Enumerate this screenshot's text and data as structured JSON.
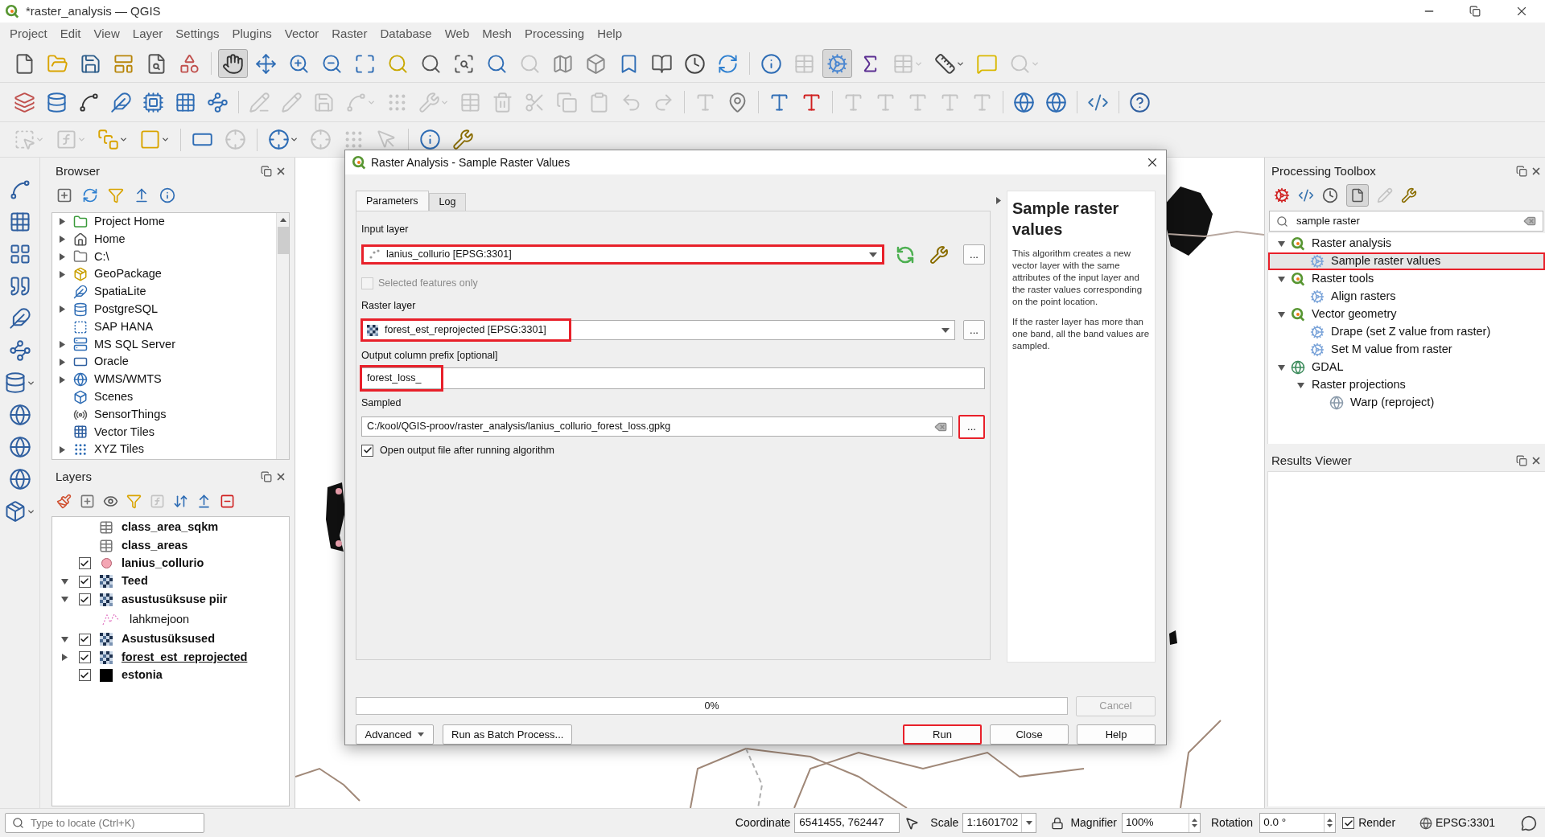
{
  "window": {
    "title": "*raster_analysis — QGIS"
  },
  "menu": [
    "Project",
    "Edit",
    "View",
    "Layer",
    "Settings",
    "Plugins",
    "Vector",
    "Raster",
    "Database",
    "Web",
    "Mesh",
    "Processing",
    "Help"
  ],
  "toolbars": [
    {
      "buttons": [
        {
          "disabled": false,
          "pressed": false
        },
        {
          "disabled": false,
          "pressed": false
        },
        {
          "disabled": false,
          "pressed": false
        },
        {
          "disabled": false,
          "pressed": false
        },
        {
          "disabled": false,
          "pressed": false
        },
        {
          "disabled": false,
          "pressed": false
        },
        {
          "disabled": false,
          "pressed": true
        },
        {
          "disabled": false,
          "pressed": false
        },
        {
          "disabled": false,
          "pressed": false
        },
        {
          "disabled": false,
          "pressed": false
        },
        {
          "disabled": false,
          "pressed": false
        },
        {
          "disabled": false,
          "pressed": false
        },
        {
          "disabled": false,
          "pressed": false
        },
        {
          "disabled": false,
          "pressed": false
        },
        {
          "disabled": false,
          "pressed": false
        },
        {
          "disabled": true,
          "pressed": false
        },
        {
          "disabled": false,
          "pressed": false
        },
        {
          "disabled": false,
          "pressed": false
        },
        {
          "disabled": false,
          "pressed": false
        },
        {
          "disabled": false,
          "pressed": false
        },
        {
          "disabled": false,
          "pressed": false
        },
        {
          "disabled": false,
          "pressed": false
        },
        {
          "disabled": false,
          "pressed": false
        },
        {
          "disabled": true,
          "pressed": false
        },
        {
          "disabled": false,
          "pressed": true
        },
        {
          "disabled": false,
          "pressed": false
        },
        {
          "disabled": true,
          "pressed": false
        },
        {
          "disabled": false,
          "pressed": false
        },
        {
          "disabled": false,
          "pressed": false
        },
        {
          "disabled": true,
          "pressed": false
        }
      ]
    },
    {
      "buttons": [
        {
          "disabled": false
        },
        {
          "disabled": false
        },
        {
          "disabled": false
        },
        {
          "disabled": false
        },
        {
          "disabled": false
        },
        {
          "disabled": false
        },
        {
          "disabled": false
        },
        {
          "disabled": true
        },
        {
          "disabled": true
        },
        {
          "disabled": true
        },
        {
          "disabled": true
        },
        {
          "disabled": true
        },
        {
          "disabled": true
        },
        {
          "disabled": true
        },
        {
          "disabled": true
        },
        {
          "disabled": true
        },
        {
          "disabled": true
        },
        {
          "disabled": true
        },
        {
          "disabled": true
        },
        {
          "disabled": true
        },
        {
          "disabled": true
        },
        {
          "disabled": false
        },
        {
          "disabled": false
        },
        {
          "disabled": false
        },
        {
          "disabled": true
        },
        {
          "disabled": true
        },
        {
          "disabled": true
        },
        {
          "disabled": true
        },
        {
          "disabled": true
        },
        {
          "disabled": false
        },
        {
          "disabled": false
        },
        {
          "disabled": false
        },
        {
          "disabled": false
        }
      ]
    },
    {
      "buttons": [
        {
          "disabled": true
        },
        {
          "disabled": true
        },
        {
          "disabled": false
        },
        {
          "disabled": false
        },
        {
          "disabled": false
        },
        {
          "disabled": true
        },
        {
          "disabled": false
        },
        {
          "disabled": true
        },
        {
          "disabled": true
        },
        {
          "disabled": true
        },
        {
          "disabled": false
        },
        {
          "disabled": false
        }
      ]
    }
  ],
  "browser": {
    "title": "Browser",
    "items": [
      {
        "label": "Project Home",
        "expandable": true
      },
      {
        "label": "Home",
        "expandable": true
      },
      {
        "label": "C:\\",
        "expandable": true
      },
      {
        "label": "GeoPackage",
        "expandable": true
      },
      {
        "label": "SpatiaLite",
        "expandable": false
      },
      {
        "label": "PostgreSQL",
        "expandable": true
      },
      {
        "label": "SAP HANA",
        "expandable": false
      },
      {
        "label": "MS SQL Server",
        "expandable": true
      },
      {
        "label": "Oracle",
        "expandable": true
      },
      {
        "label": "WMS/WMTS",
        "expandable": true
      },
      {
        "label": "Scenes",
        "expandable": false
      },
      {
        "label": "SensorThings",
        "expandable": false
      },
      {
        "label": "Vector Tiles",
        "expandable": false
      },
      {
        "label": "XYZ Tiles",
        "expandable": true
      }
    ]
  },
  "layers": {
    "title": "Layers",
    "items": [
      {
        "label": "class_area_sqkm",
        "kind": "table",
        "underlined": false
      },
      {
        "label": "class_areas",
        "kind": "table",
        "underlined": false
      },
      {
        "label": "lanius_collurio",
        "kind": "points",
        "checked": true,
        "underlined": false
      },
      {
        "label": "Teed",
        "kind": "raster",
        "checked": true,
        "expanded": true,
        "underlined": false
      },
      {
        "label": "asustusüksuse piir",
        "kind": "raster",
        "checked": true,
        "expanded": true,
        "underlined": false,
        "children": [
          {
            "label": "lahkmejoon",
            "kind": "line"
          }
        ]
      },
      {
        "label": "Asustusüksused",
        "kind": "raster",
        "checked": true,
        "expanded": true,
        "underlined": false
      },
      {
        "label": "forest_est_reprojected",
        "kind": "raster",
        "checked": true,
        "expanded": false,
        "underlined": true
      },
      {
        "label": "estonia",
        "kind": "polygon",
        "checked": true,
        "underlined": false
      }
    ]
  },
  "dialog": {
    "title": "Raster Analysis - Sample Raster Values",
    "tabs": [
      {
        "label": "Parameters",
        "selected": true
      },
      {
        "label": "Log",
        "selected": false
      }
    ],
    "input_layer": {
      "label": "Input layer",
      "value": "lanius_collurio [EPSG:3301]",
      "browse": "...",
      "highlighted": true
    },
    "selected_features_only": {
      "label": "Selected features only",
      "checked": false,
      "disabled": true
    },
    "raster_layer": {
      "label": "Raster layer",
      "value": "forest_est_reprojected [EPSG:3301]",
      "browse": "...",
      "highlighted": true
    },
    "output_prefix": {
      "label": "Output column prefix [optional]",
      "value": "forest_loss_",
      "highlighted": true
    },
    "sampled": {
      "label": "Sampled",
      "value": "C:/kool/QGIS-proov/raster_analysis/lanius_collurio_forest_loss.gpkg",
      "browse": "...",
      "browse_highlighted": true
    },
    "open_output": {
      "label": "Open output file after running algorithm",
      "checked": true
    },
    "help": {
      "title": "Sample raster values",
      "paragraphs": [
        "This algorithm creates a new vector layer with the same attributes of the input layer and the raster values corresponding on the point location.",
        "If the raster layer has more than one band, all the band values are sampled."
      ]
    },
    "progress": {
      "level": 0,
      "reading": "0%"
    },
    "cancel": {
      "label": "Cancel",
      "disabled": true
    },
    "left_buttons": [
      {
        "label": "Advanced",
        "dropdown": true
      },
      {
        "label": "Run as Batch Process...",
        "dropdown": false
      }
    ],
    "right_buttons": [
      {
        "label": "Run",
        "highlighted": true
      },
      {
        "label": "Close",
        "highlighted": false
      },
      {
        "label": "Help",
        "highlighted": false
      }
    ]
  },
  "toolbox": {
    "title": "Processing Toolbox",
    "search": "sample raster",
    "tree": [
      {
        "label": "Raster analysis",
        "kind": "provider",
        "expanded": true,
        "selected": false,
        "children": [
          {
            "label": "Sample raster values",
            "kind": "algorithm",
            "selected": true,
            "highlighted": true
          }
        ]
      },
      {
        "label": "Raster tools",
        "kind": "provider",
        "expanded": true,
        "selected": false,
        "children": [
          {
            "label": "Align rasters",
            "kind": "algorithm",
            "selected": false,
            "highlighted": false
          }
        ]
      },
      {
        "label": "Vector geometry",
        "kind": "provider",
        "expanded": true,
        "selected": false,
        "children": [
          {
            "label": "Drape (set Z value from raster)",
            "kind": "algorithm",
            "selected": false,
            "highlighted": false
          },
          {
            "label": "Set M value from raster",
            "kind": "algorithm",
            "selected": false,
            "highlighted": false
          }
        ]
      },
      {
        "label": "GDAL",
        "kind": "gdal",
        "expanded": true,
        "selected": false,
        "children": [
          {
            "label": "Raster projections",
            "kind": "group",
            "expanded": true,
            "selected": false,
            "children": [
              {
                "label": "Warp (reproject)",
                "kind": "gdal_algorithm",
                "selected": false,
                "highlighted": false
              }
            ]
          }
        ]
      }
    ]
  },
  "results_viewer": {
    "title": "Results Viewer"
  },
  "status_bar": {
    "locate_placeholder": "Type to locate (Ctrl+K)",
    "coordinate_label": "Coordinate",
    "coordinate": "6541455, 762447",
    "scale_label": "Scale",
    "scale": "1:1601702",
    "magnifier_label": "Magnifier",
    "magnifier": "100%",
    "rotation_label": "Rotation",
    "rotation": "0.0 °",
    "render": {
      "label": "Render",
      "checked": true
    },
    "crs": "EPSG:3301"
  }
}
